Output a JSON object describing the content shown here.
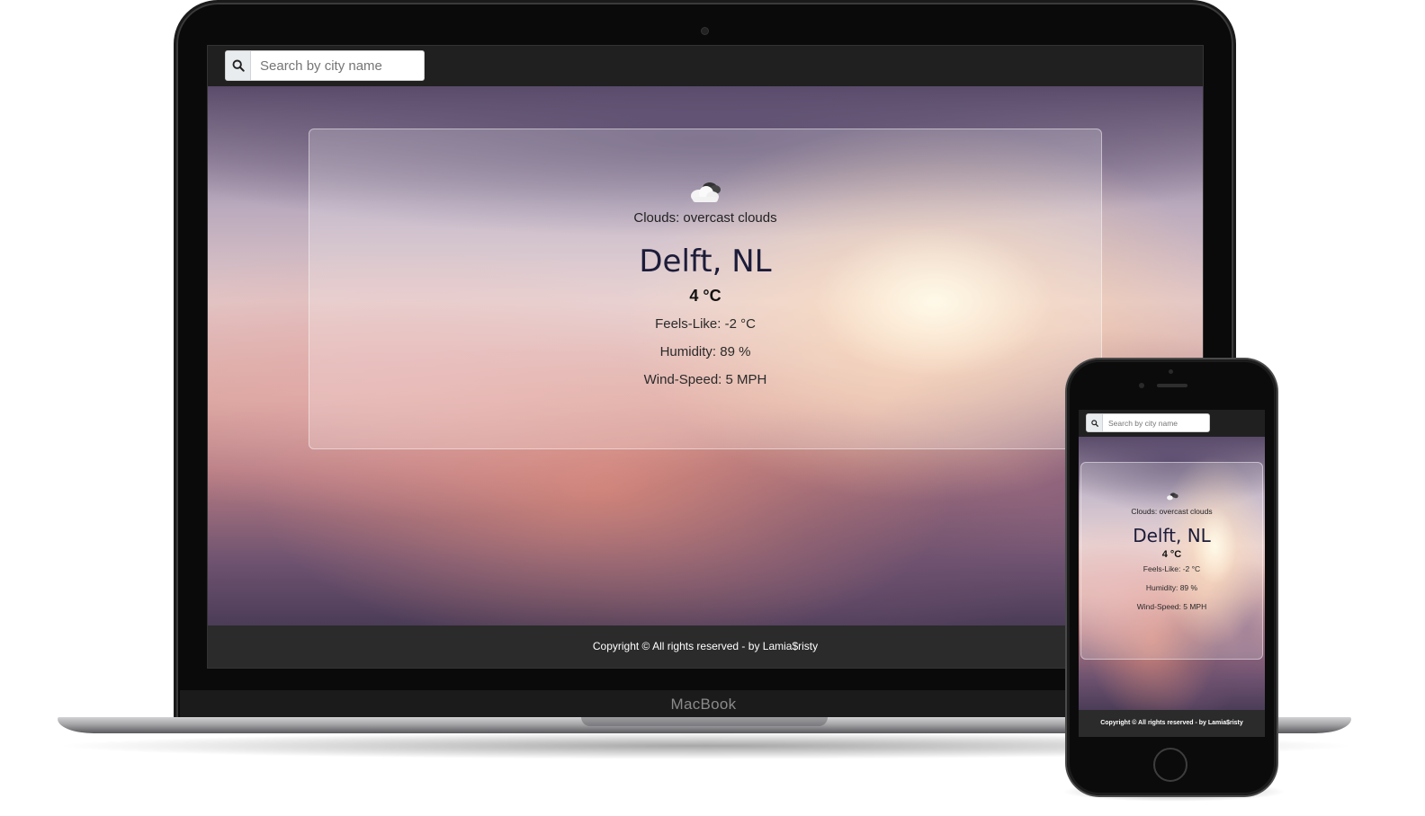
{
  "app": {
    "search_placeholder": "Search by city name",
    "weather": {
      "icon": "overcast-clouds-icon",
      "description": "Clouds: overcast clouds",
      "city": "Delft, NL",
      "temperature": "4 °C",
      "feels_like": "Feels-Like: -2 °C",
      "humidity": "Humidity: 89 %",
      "wind_speed": "Wind-Speed: 5 MPH"
    },
    "footer": "Copyright © All rights reserved - by Lamia$risty"
  },
  "device": {
    "laptop_brand": "MacBook"
  },
  "colors": {
    "topbar": "#202020",
    "footer": "#2b2b2b",
    "city_text": "#1c1c3a"
  }
}
